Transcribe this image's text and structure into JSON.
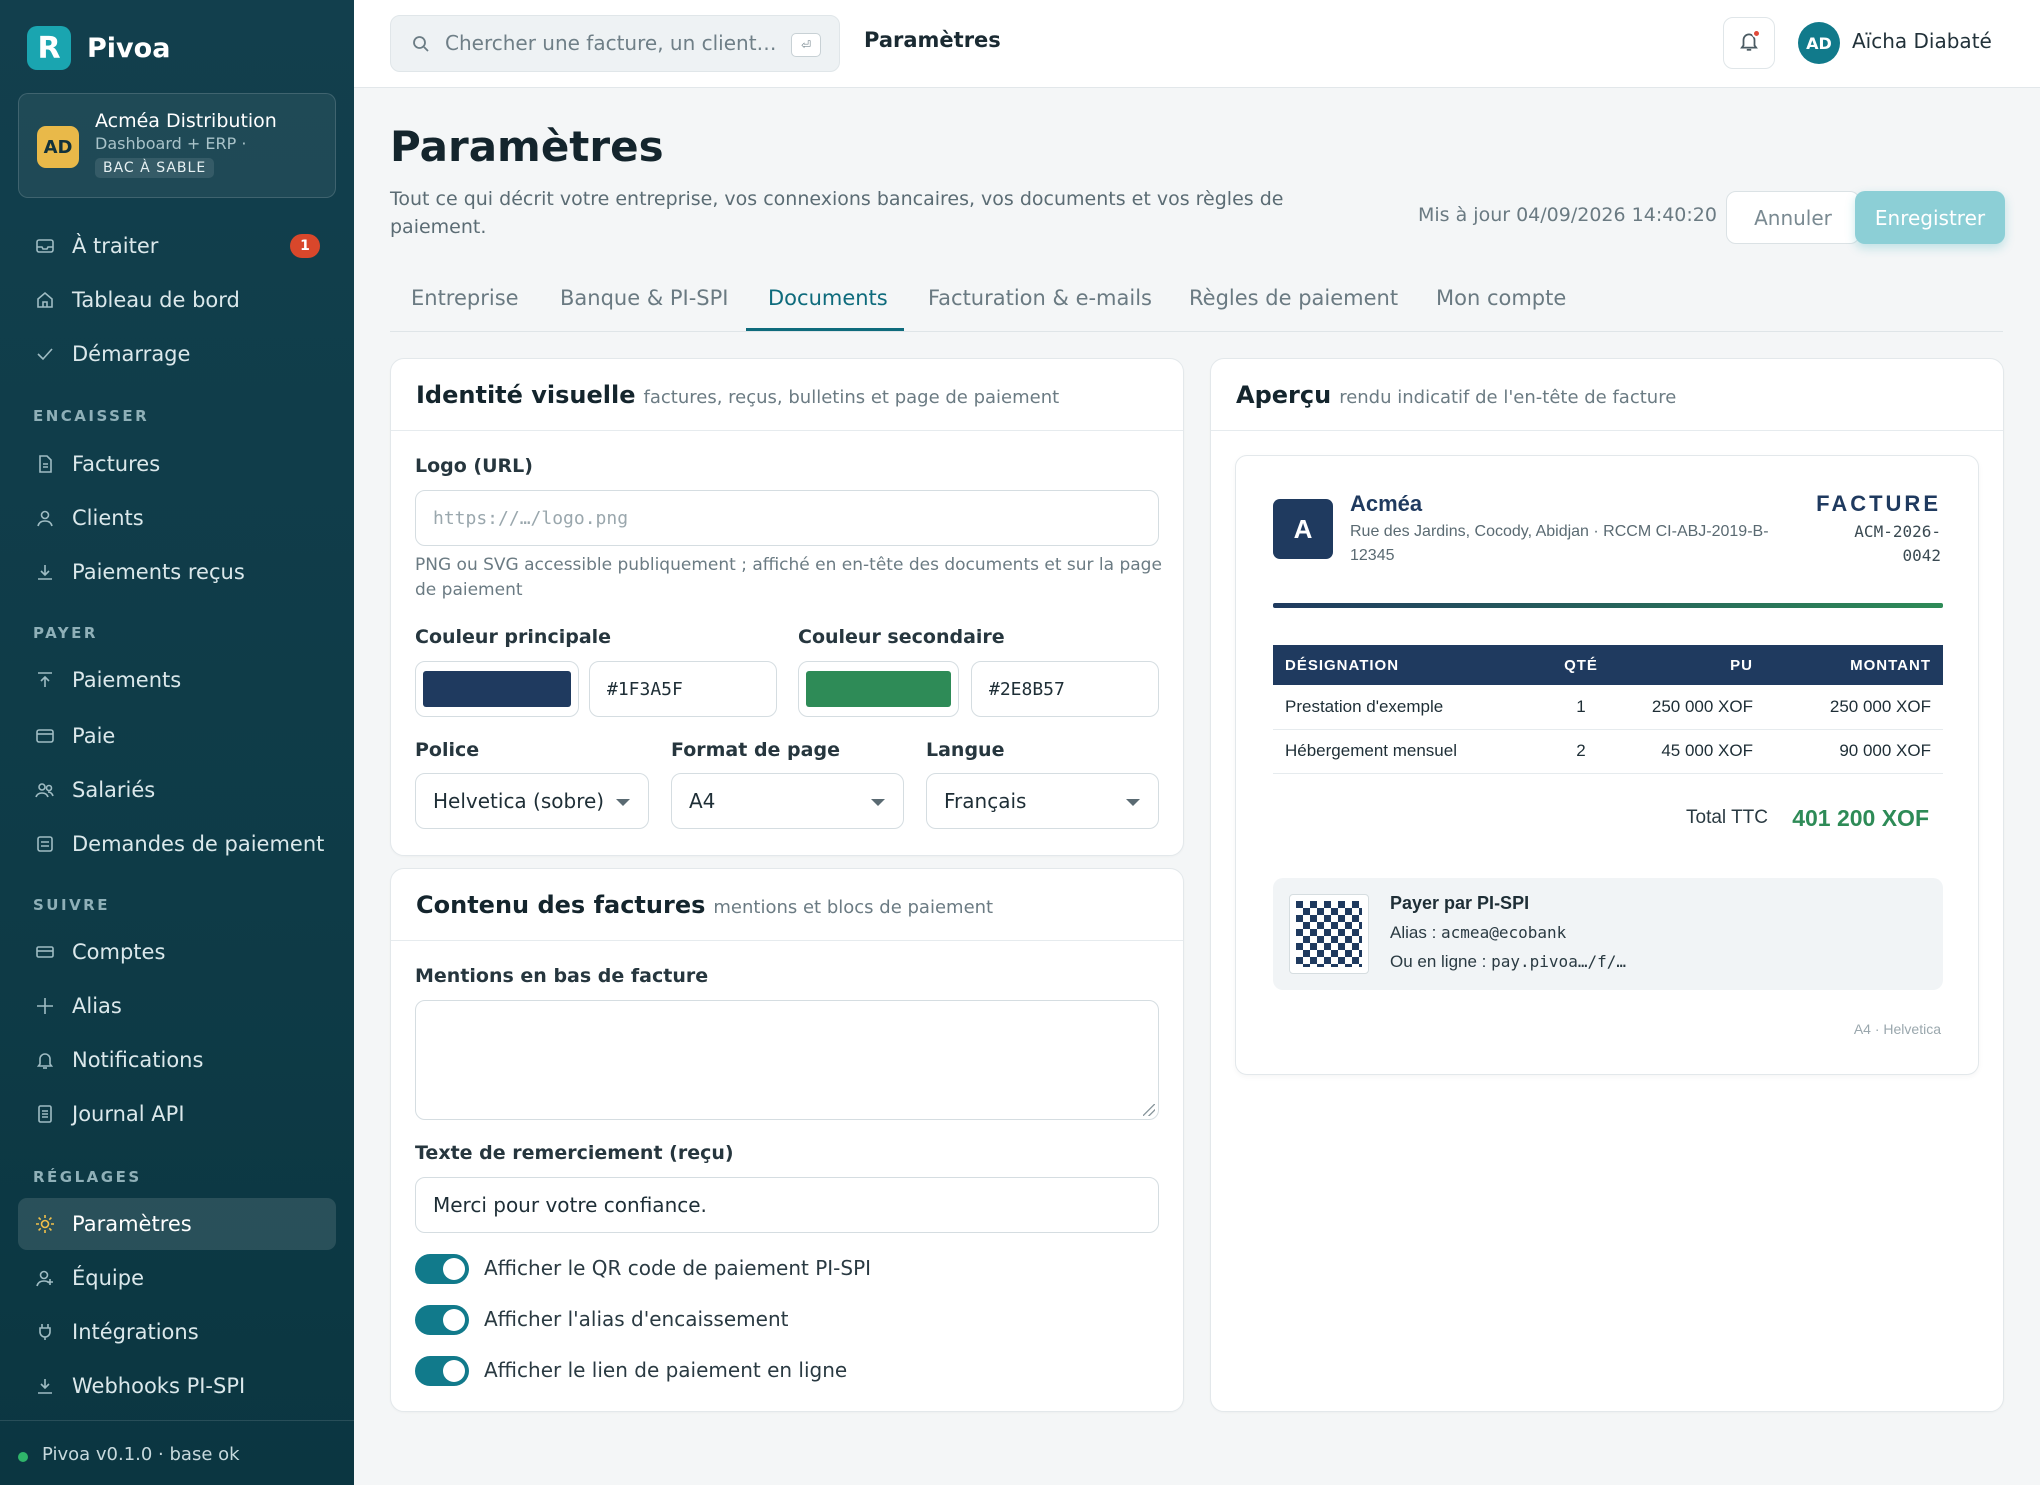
{
  "app": {
    "name": "Pivoa",
    "logo_letter": "R"
  },
  "org": {
    "initials": "AD",
    "name": "Acméa Distribution",
    "sub": "Dashboard + ERP ·",
    "badge": "BAC À SABLE"
  },
  "nav": {
    "top": [
      {
        "label": "À traiter",
        "icon": "inbox-icon",
        "badge": "1"
      },
      {
        "label": "Tableau de bord",
        "icon": "home-icon"
      },
      {
        "label": "Démarrage",
        "icon": "check-icon"
      }
    ],
    "sections": [
      {
        "title": "ENCAISSER",
        "items": [
          {
            "label": "Factures",
            "icon": "file-icon"
          },
          {
            "label": "Clients",
            "icon": "user-icon"
          },
          {
            "label": "Paiements reçus",
            "icon": "download-icon"
          }
        ]
      },
      {
        "title": "PAYER",
        "items": [
          {
            "label": "Paiements",
            "icon": "upload-icon"
          },
          {
            "label": "Paie",
            "icon": "card-icon"
          },
          {
            "label": "Salariés",
            "icon": "users-icon"
          },
          {
            "label": "Demandes de paiement",
            "icon": "list-icon"
          }
        ]
      },
      {
        "title": "SUIVRE",
        "items": [
          {
            "label": "Comptes",
            "icon": "bank-icon"
          },
          {
            "label": "Alias",
            "icon": "plus-icon"
          },
          {
            "label": "Notifications",
            "icon": "bell-icon"
          },
          {
            "label": "Journal API",
            "icon": "log-icon"
          }
        ]
      },
      {
        "title": "RÉGLAGES",
        "items": [
          {
            "label": "Paramètres",
            "icon": "sun-icon",
            "active": true
          },
          {
            "label": "Équipe",
            "icon": "team-icon"
          },
          {
            "label": "Intégrations",
            "icon": "plug-icon"
          },
          {
            "label": "Webhooks PI-SPI",
            "icon": "webhook-icon"
          }
        ]
      }
    ]
  },
  "footer": {
    "version": "Pivoa v0.1.0 · base ok",
    "status_color": "#2fb56a"
  },
  "topbar": {
    "search_placeholder": "Chercher une facture, un client…",
    "search_kbd": "⏎",
    "breadcrumb": "Paramètres",
    "user_initials": "AD",
    "user_name": "Aïcha Diabaté"
  },
  "page": {
    "title": "Paramètres",
    "description": "Tout ce qui décrit votre entreprise, vos connexions bancaires, vos documents et vos règles de paiement.",
    "updated": "Mis à jour 04/09/2026 14:40:20",
    "cancel": "Annuler",
    "save": "Enregistrer"
  },
  "tabs": [
    {
      "label": "Entreprise"
    },
    {
      "label": "Banque & PI-SPI"
    },
    {
      "label": "Documents",
      "active": true
    },
    {
      "label": "Facturation & e-mails"
    },
    {
      "label": "Règles de paiement"
    },
    {
      "label": "Mon compte"
    }
  ],
  "identity": {
    "title": "Identité visuelle",
    "subtitle": "factures, reçus, bulletins et page de paiement",
    "logo_label": "Logo (URL)",
    "logo_placeholder": "https://…/logo.png",
    "logo_help": "PNG ou SVG accessible publiquement ; affiché en en-tête des documents et sur la page de paiement",
    "primary_label": "Couleur principale",
    "primary_value": "#1F3A5F",
    "secondary_label": "Couleur secondaire",
    "secondary_value": "#2E8B57",
    "font_label": "Police",
    "font_value": "Helvetica (sobre)",
    "format_label": "Format de page",
    "format_value": "A4",
    "lang_label": "Langue",
    "lang_value": "Français"
  },
  "content": {
    "title": "Contenu des factures",
    "subtitle": "mentions et blocs de paiement",
    "mentions_label": "Mentions en bas de facture",
    "mentions_value": "",
    "thanks_label": "Texte de remerciement (reçu)",
    "thanks_value": "Merci pour votre confiance.",
    "toggles": [
      {
        "label": "Afficher le QR code de paiement PI-SPI",
        "on": true
      },
      {
        "label": "Afficher l'alias d'encaissement",
        "on": true
      },
      {
        "label": "Afficher le lien de paiement en ligne",
        "on": true
      }
    ]
  },
  "preview": {
    "title": "Aperçu",
    "subtitle": "rendu indicatif de l'en-tête de facture",
    "logo_letter": "A",
    "company": "Acméa",
    "address": "Rue des Jardins, Cocody, Abidjan · RCCM CI-ABJ-2019-B-12345",
    "doc_kind": "FACTURE",
    "doc_number": "ACM-2026-0042",
    "columns": [
      "DÉSIGNATION",
      "QTÉ",
      "PU",
      "MONTANT"
    ],
    "rows": [
      [
        "Prestation d'exemple",
        "1",
        "250 000 XOF",
        "250 000 XOF"
      ],
      [
        "Hébergement mensuel",
        "2",
        "45 000 XOF",
        "90 000 XOF"
      ]
    ],
    "total_label": "Total TTC",
    "total_value": "401 200 XOF",
    "pay_title": "Payer par PI-SPI",
    "alias_label": "Alias : ",
    "alias_value": "acmea@ecobank",
    "link_label": "Ou en ligne : ",
    "link_value": "pay.pivoa…/f/…",
    "footer": "A4 · Helvetica"
  }
}
